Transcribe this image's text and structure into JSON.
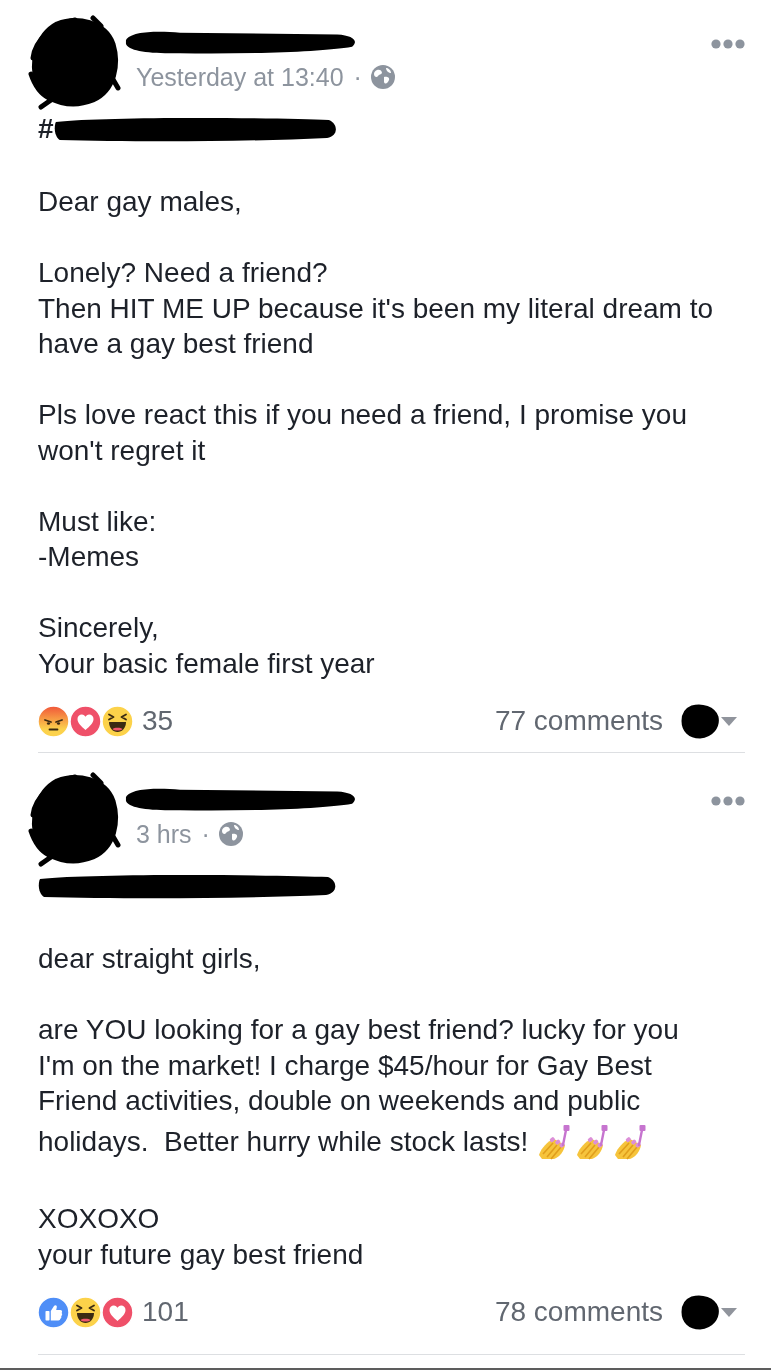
{
  "posts": [
    {
      "author": {
        "avatar_scribbled": true,
        "name_scribbled": true
      },
      "time": "Yesterday at 13:40",
      "separator": "·",
      "tag": {
        "prefix": "#",
        "scribbled": true
      },
      "paragraphs": [
        {
          "lines": [
            "Dear gay males,"
          ]
        },
        {
          "lines": [
            "Lonely? Need a friend?",
            "Then HIT ME UP because it's been my literal dream to",
            "have a gay best friend"
          ]
        },
        {
          "lines": [
            "Pls love react this if you need a friend, I promise you",
            "won't regret it"
          ]
        },
        {
          "lines": [
            "Must like:",
            "-Memes"
          ]
        },
        {
          "lines": [
            "Sincerely,",
            "Your basic female first year"
          ]
        }
      ],
      "reactions": [
        {
          "kind": "angry"
        },
        {
          "kind": "love"
        },
        {
          "kind": "haha"
        }
      ],
      "reaction_count": "35",
      "comment_count": "77 comments",
      "commenter_scribbled": true
    },
    {
      "author": {
        "avatar_scribbled": true,
        "name_scribbled": true
      },
      "time": "3 hrs",
      "separator": "·",
      "tag": {
        "scribbled": true
      },
      "paragraphs": [
        {
          "lines": [
            "dear straight girls,"
          ]
        },
        {
          "lines": [
            "are YOU looking for a gay best friend? lucky for you",
            "I'm on the market! I charge $45/hour for Gay Best",
            "Friend activities, double on weekends and public",
            "holidays.  Better hurry while stock lasts!"
          ],
          "emoji": [
            {
              "kind": "nail-polish"
            },
            {
              "kind": "nail-polish"
            },
            {
              "kind": "nail-polish"
            }
          ]
        },
        {
          "lines": [
            "XOXOXO",
            "your future gay best friend"
          ]
        }
      ],
      "reactions": [
        {
          "kind": "like"
        },
        {
          "kind": "haha"
        },
        {
          "kind": "love"
        }
      ],
      "reaction_count": "101",
      "comment_count": "78 comments",
      "commenter_scribbled": true
    }
  ]
}
